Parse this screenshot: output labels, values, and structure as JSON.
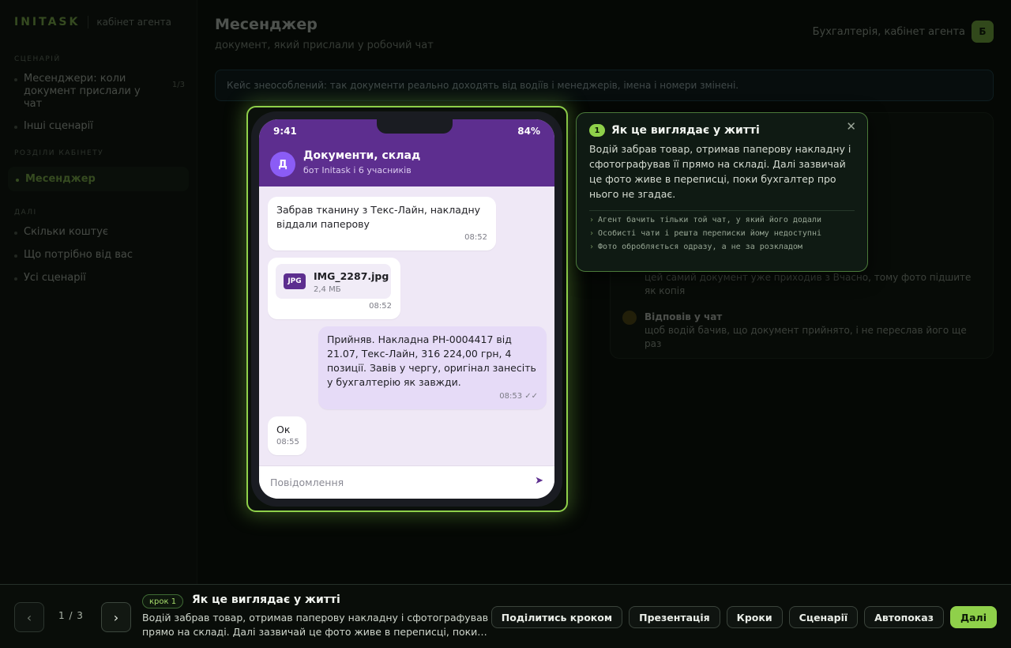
{
  "app": {
    "brand": "INITASK",
    "brand_sub": "кабінет агента",
    "sections": {
      "scenario": "СЦЕНАРІЙ",
      "chapter": "РОЗДІЛИ КАБІНЕТУ",
      "next": "ДАЛІ"
    },
    "scenario_items": [
      {
        "label": "Месенджери: коли документ прислали у чат",
        "count": "1/3"
      },
      {
        "label": "Інші сценарії"
      }
    ],
    "chapter_items": [
      {
        "label": "Месенджер"
      }
    ],
    "next_items": [
      {
        "label": "Скільки коштує"
      },
      {
        "label": "Що потрібно від вас"
      },
      {
        "label": "Усі сценарії"
      }
    ],
    "page_title": "Месенджер",
    "page_subtitle": "документ, який прислали у робочий чат",
    "account_label": "Бухгалтерія, кабінет агента",
    "account_badge": "Б",
    "notice": "Кейс знеособлений: так документи реально доходять від водіїв і менеджерів, імена і номери змінені.",
    "bg_steps": [
      {
        "text": "цей самий документ уже приходив з Вчасно, тому фото підшите як копія"
      },
      {
        "title": "Відповів у чат",
        "text": "щоб водій бачив, що документ прийнято, і не переслав його ще раз"
      }
    ]
  },
  "phone": {
    "time": "9:41",
    "battery": "84%",
    "avatar_letter": "Д",
    "chat_name": "Документи, склад",
    "chat_members": "бот Initask і 6 учасників",
    "messages": [
      {
        "text": "Забрав тканину з Текс-Лайн, накладну віддали паперову",
        "time": "08:52"
      },
      {
        "file_type": "JPG",
        "file_name": "IMG_2287.jpg",
        "file_size": "2,4 МБ",
        "time": "08:52"
      },
      {
        "text": "Прийняв. Накладна РН-0004417 від 21.07, Текс-Лайн, 316 224,00 грн, 4 позиції. Завів у чергу, оригінал занесіть у бухгалтерію як завжди.",
        "time": "08:53 ✓✓"
      },
      {
        "text": "Ок",
        "time": "08:55"
      }
    ],
    "composer_placeholder": "Повідомлення"
  },
  "popover": {
    "step_number": "1",
    "title": "Як це виглядає у житті",
    "text": "Водій забрав товар, отримав паперову накладну і сфотографував її прямо на складі. Далі зазвичай це фото живе в переписці, поки бухгалтер про нього не згадає.",
    "points": [
      "Агент бачить тільки той чат, у який його додали",
      "Особисті чати і решта переписки йому недоступні",
      "Фото обробляється одразу, а не за розкладом"
    ]
  },
  "tourbar": {
    "pager": "1 / 3",
    "step_pill": "крок 1",
    "title": "Як це виглядає у житті",
    "text": "Водій забрав товар, отримав паперову накладну і сфотографував її прямо на складі. Далі зазвичай це фото живе в переписці, поки…",
    "buttons": {
      "share": "Поділитись кроком",
      "presentation": "Презентація",
      "steps": "Кроки",
      "scenarios": "Сценарії",
      "autoplay": "Автопоказ",
      "next": "Далі"
    }
  }
}
